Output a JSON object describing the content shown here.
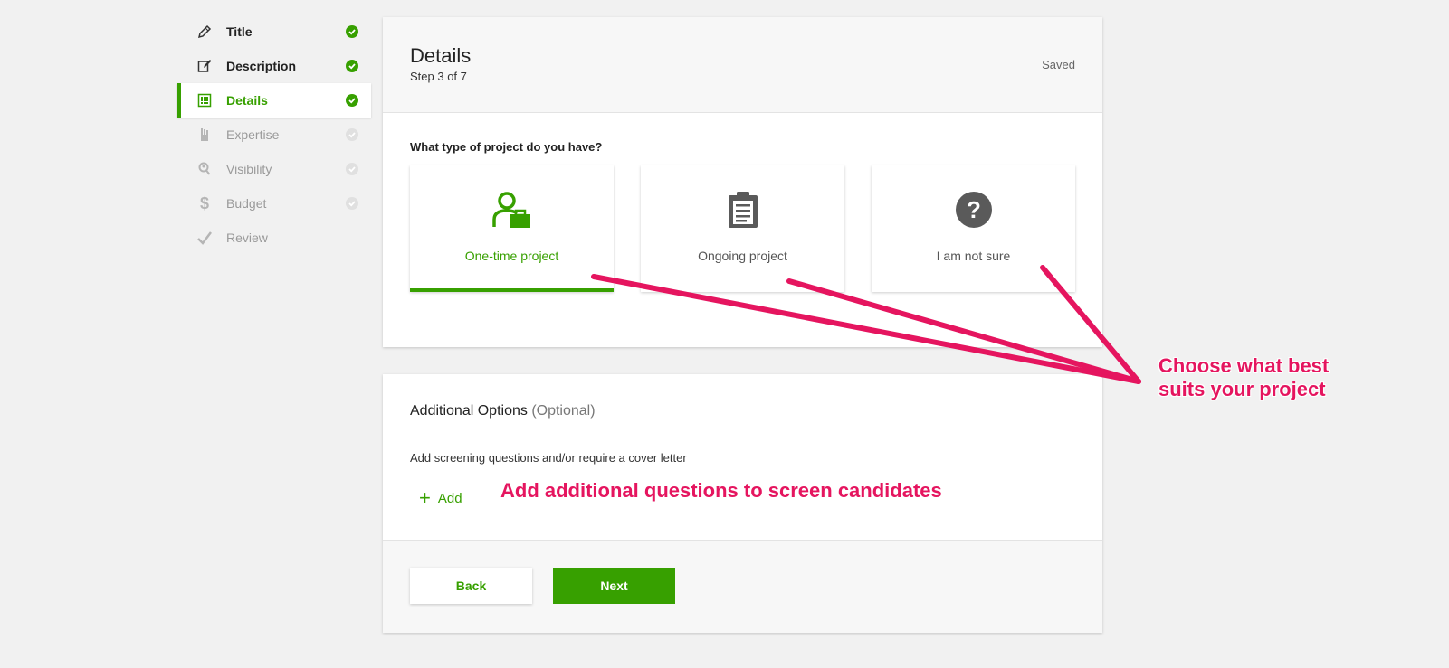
{
  "sidebar": {
    "items": [
      {
        "label": "Title",
        "icon": "pencil-icon",
        "state": "done"
      },
      {
        "label": "Description",
        "icon": "edit-note-icon",
        "state": "done"
      },
      {
        "label": "Details",
        "icon": "list-icon",
        "state": "active"
      },
      {
        "label": "Expertise",
        "icon": "tools-icon",
        "state": "pending"
      },
      {
        "label": "Visibility",
        "icon": "person-search-icon",
        "state": "pending"
      },
      {
        "label": "Budget",
        "icon": "dollar-icon",
        "state": "pending"
      },
      {
        "label": "Review",
        "icon": "checkmark-icon",
        "state": "review"
      }
    ]
  },
  "details": {
    "title": "Details",
    "step": "Step 3 of 7",
    "saved": "Saved",
    "question": "What type of project do you have?",
    "options": [
      {
        "label": "One-time project",
        "icon": "person-briefcase-icon",
        "selected": true
      },
      {
        "label": "Ongoing project",
        "icon": "clipboard-icon",
        "selected": false
      },
      {
        "label": "I am not sure",
        "icon": "question-icon",
        "selected": false
      }
    ]
  },
  "additional": {
    "title": "Additional Options",
    "optional": "(Optional)",
    "description": "Add screening questions and/or require a cover letter",
    "add_label": "Add"
  },
  "footer": {
    "back_label": "Back",
    "next_label": "Next"
  },
  "annotations": {
    "choose_line1": "Choose what best",
    "choose_line2": "suits your project",
    "add_questions": "Add additional questions to screen candidates"
  },
  "colors": {
    "accent": "#37a000",
    "annotation": "#e5155f",
    "background": "#f1f1f1"
  }
}
